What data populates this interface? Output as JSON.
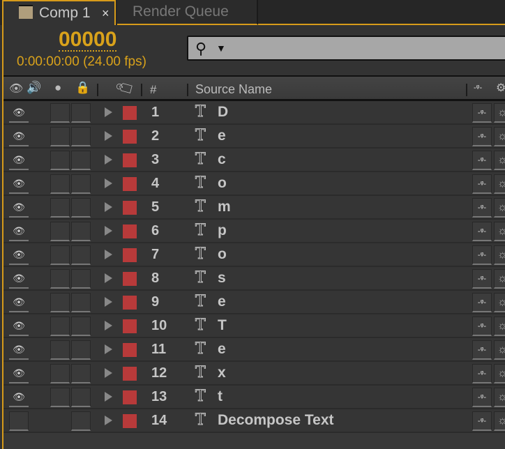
{
  "tabs": [
    {
      "label": "Comp 1",
      "active": true,
      "close": "×",
      "swatch_color": "#b09e7c"
    },
    {
      "label": "Render Queue",
      "active": false
    }
  ],
  "accent_color": "#d79b1a",
  "timeline": {
    "frame": "00000",
    "timecode": "0:00:00:00 (24.00 fps)"
  },
  "search": {
    "icon": "magnifier-icon",
    "dropdown": "▼",
    "value": ""
  },
  "columns": {
    "av": [
      "eye-icon",
      "speaker-icon",
      "solo-icon",
      "lock-icon"
    ],
    "label": "tag-icon",
    "number": "#",
    "source_name": "Source Name",
    "switches": [
      "shy-icon",
      "gear-icon"
    ]
  },
  "layers": [
    {
      "num": "1",
      "name": "D",
      "visible": true,
      "solo_box": true
    },
    {
      "num": "2",
      "name": "e",
      "visible": true,
      "solo_box": true
    },
    {
      "num": "3",
      "name": "c",
      "visible": true,
      "solo_box": true
    },
    {
      "num": "4",
      "name": "o",
      "visible": true,
      "solo_box": true
    },
    {
      "num": "5",
      "name": "m",
      "visible": true,
      "solo_box": true
    },
    {
      "num": "6",
      "name": "p",
      "visible": true,
      "solo_box": true
    },
    {
      "num": "7",
      "name": "o",
      "visible": true,
      "solo_box": true
    },
    {
      "num": "8",
      "name": "s",
      "visible": true,
      "solo_box": true
    },
    {
      "num": "9",
      "name": "e",
      "visible": true,
      "solo_box": true
    },
    {
      "num": "10",
      "name": "T",
      "visible": true,
      "solo_box": true
    },
    {
      "num": "11",
      "name": "e",
      "visible": true,
      "solo_box": true
    },
    {
      "num": "12",
      "name": "x",
      "visible": true,
      "solo_box": true
    },
    {
      "num": "13",
      "name": "t",
      "visible": true,
      "solo_box": true
    },
    {
      "num": "14",
      "name": "Decompose Text",
      "visible": false,
      "solo_box": false
    }
  ],
  "label_color": "#b83a3a"
}
